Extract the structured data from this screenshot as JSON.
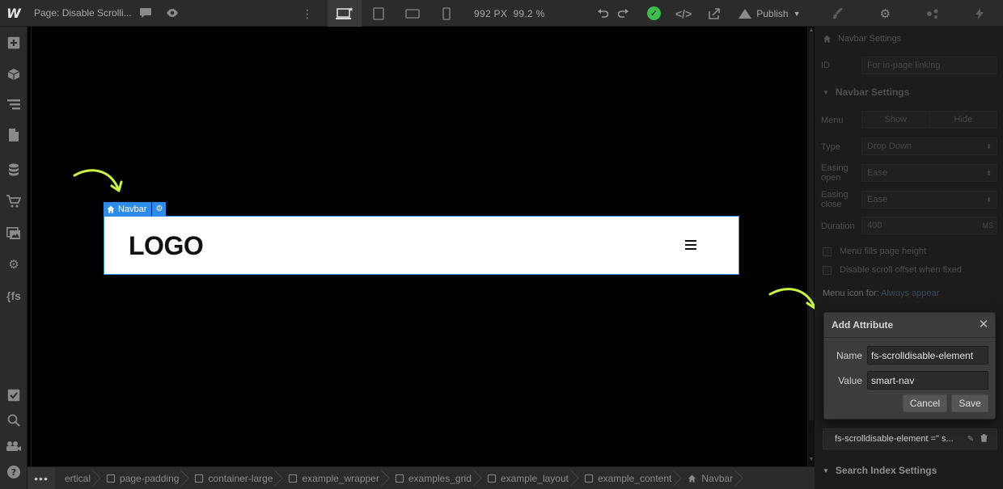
{
  "topbar": {
    "logo": "W",
    "page_name": "Page: Disable Scrolli...",
    "size_px": "992 PX",
    "zoom": "99.2 %",
    "publish_label": "Publish"
  },
  "canvas": {
    "navbar_tag": "Navbar",
    "logo_text": "LOGO"
  },
  "breadcrumbs": [
    "ertical",
    "page-padding",
    "container-large",
    "example_wrapper",
    "examples_grid",
    "example_layout",
    "example_content",
    "Navbar"
  ],
  "right_panel": {
    "breadcrumb_title": "Navbar Settings",
    "id_label": "ID",
    "id_placeholder": "For in-page linking",
    "section_title": "Navbar Settings",
    "menu_label": "Menu",
    "menu_show": "Show",
    "menu_hide": "Hide",
    "type_label": "Type",
    "type_value": "Drop Down",
    "easing_open_label": "Easing open",
    "easing_open_value": "Ease",
    "easing_close_label": "Easing close",
    "easing_close_value": "Ease",
    "duration_label": "Duration",
    "duration_value": "400",
    "duration_unit": "MS",
    "check_fills": "Menu fills page height",
    "check_disable": "Disable scroll offset when fixed",
    "menu_icon_label": "Menu icon for:",
    "menu_icon_value": "Always appear",
    "attribute_row": "fs-scrolldisable-element =\" s...",
    "search_index": "Search Index Settings"
  },
  "modal": {
    "title": "Add Attribute",
    "name_label": "Name",
    "name_value": "fs-scrolldisable-element",
    "value_label": "Value",
    "value_value": "smart-nav",
    "cancel_label": "Cancel",
    "save_label": "Save"
  },
  "colors": {
    "selection_blue": "#2d8ceb",
    "arrow_green": "#c8f542",
    "status_green": "#3dbd4f"
  }
}
